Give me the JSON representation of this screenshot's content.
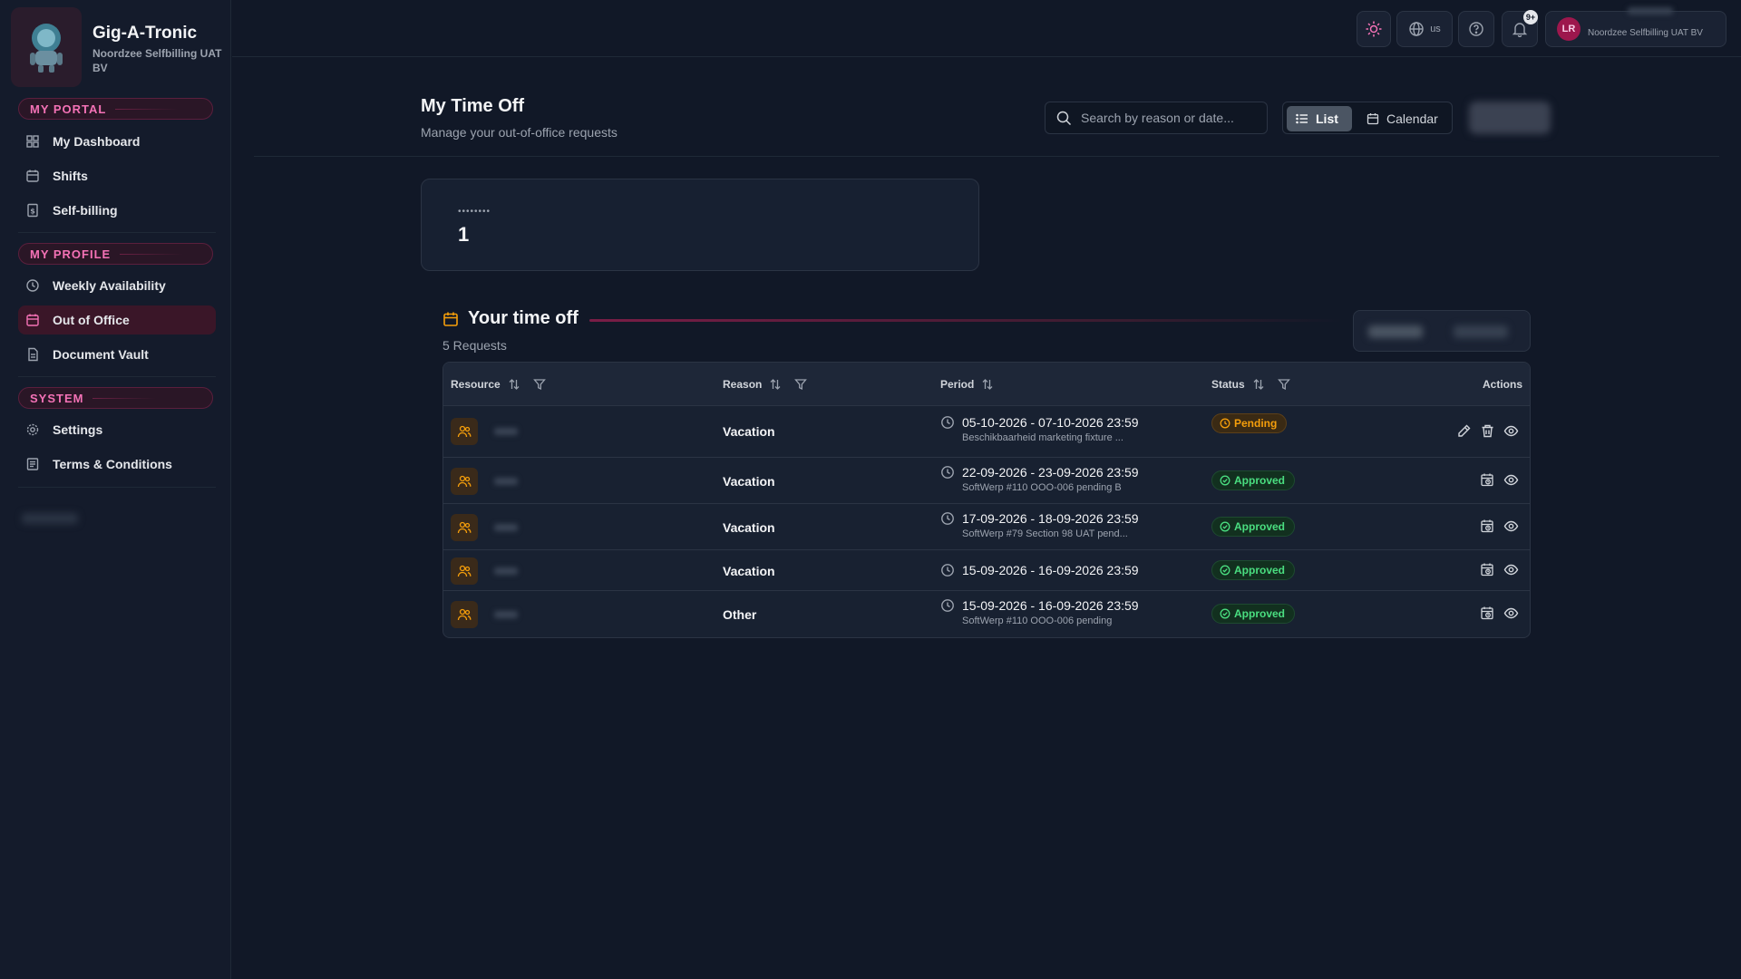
{
  "brand": {
    "title": "Gig-A-Tronic",
    "subtitle": "Noordzee Selfbilling UAT BV"
  },
  "sidebar": {
    "sections": [
      {
        "label": "MY PORTAL",
        "items": [
          {
            "label": "My Dashboard",
            "icon": "dashboard-icon"
          },
          {
            "label": "Shifts",
            "icon": "calendar-icon"
          },
          {
            "label": "Self-billing",
            "icon": "billing-icon"
          }
        ]
      },
      {
        "label": "MY PROFILE",
        "items": [
          {
            "label": "Weekly Availability",
            "icon": "clock-icon"
          },
          {
            "label": "Out of Office",
            "icon": "calendar-icon",
            "active": true
          },
          {
            "label": "Document Vault",
            "icon": "document-icon"
          }
        ]
      },
      {
        "label": "SYSTEM",
        "items": [
          {
            "label": "Settings",
            "icon": "gear-icon"
          },
          {
            "label": "Terms & Conditions",
            "icon": "terms-icon"
          }
        ]
      }
    ]
  },
  "topbar": {
    "language": "us",
    "notification_badge": "9+",
    "user_initials": "LR",
    "org_name": "Noordzee Selfbilling UAT BV"
  },
  "page": {
    "title": "My Time Off",
    "subtitle": "Manage your out-of-office requests",
    "search_placeholder": "Search by reason or date...",
    "view_list": "List",
    "view_calendar": "Calendar"
  },
  "stat": {
    "label": "••••••••",
    "value": "1"
  },
  "section": {
    "title": "Your time off",
    "count": "5 Requests"
  },
  "table": {
    "columns": {
      "resource": "Resource",
      "reason": "Reason",
      "period": "Period",
      "status": "Status",
      "actions": "Actions"
    },
    "rows": [
      {
        "reason": "Vacation",
        "period": "05-10-2026 - 07-10-2026 23:59",
        "note": "Beschikbaarheid marketing fixture ...",
        "status": "Pending"
      },
      {
        "reason": "Vacation",
        "period": "22-09-2026 - 23-09-2026 23:59",
        "note": "SoftWerp #110 OOO-006 pending B",
        "status": "Approved"
      },
      {
        "reason": "Vacation",
        "period": "17-09-2026 - 18-09-2026 23:59",
        "note": "SoftWerp #79 Section 98 UAT pend...",
        "status": "Approved"
      },
      {
        "reason": "Vacation",
        "period": "15-09-2026 - 16-09-2026 23:59",
        "note": "",
        "status": "Approved"
      },
      {
        "reason": "Other",
        "period": "15-09-2026 - 16-09-2026 23:59",
        "note": "SoftWerp #110 OOO-006 pending",
        "status": "Approved"
      }
    ]
  },
  "colors": {
    "accent": "#f472b6",
    "active_bg": "#3a1628",
    "pending": "#f59e0b",
    "approved": "#4ade80",
    "resource_icon": "#f59e0b"
  }
}
